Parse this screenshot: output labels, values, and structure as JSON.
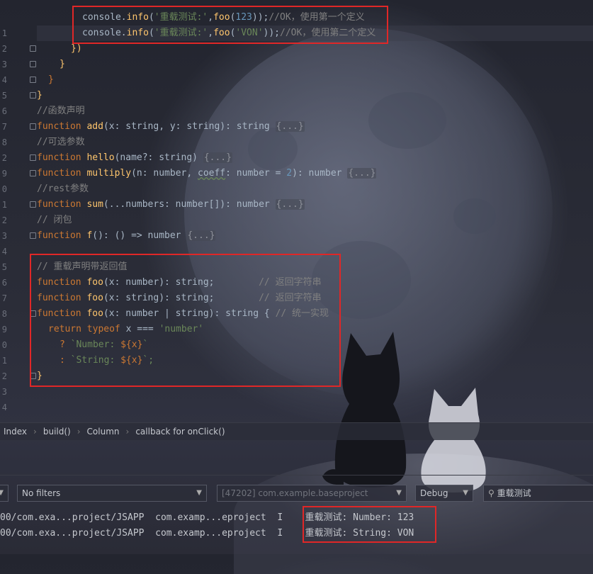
{
  "editor": {
    "line_numbers": [
      "",
      "1",
      "2",
      "3",
      "4",
      "5",
      "6",
      "7",
      "8",
      "2",
      "9",
      "0",
      "1",
      "2",
      "3",
      "4",
      "5",
      "6",
      "7",
      "8",
      "9",
      "0",
      "1",
      "2",
      "3",
      "4",
      "5"
    ],
    "box1": {
      "line1": {
        "obj": "console",
        "method": "info",
        "s1": "'重载测试:'",
        "fn": "foo",
        "arg": "123",
        "comment": "//OK，使用第一个定义"
      },
      "line2": {
        "obj": "console",
        "method": "info",
        "s1": "'重载测试:'",
        "fn": "foo",
        "arg": "'VON'",
        "comment": "//OK，使用第二个定义"
      }
    },
    "close1": "})",
    "close2": "}",
    "close3": "}",
    "close4": "}",
    "c_func_decl": "//函数声明",
    "add": {
      "kw": "function",
      "name": "add",
      "sig": "(x: string, y: string): string",
      "fold": "{...}"
    },
    "c_optional": "//可选参数",
    "hello": {
      "kw": "function",
      "name": "hello",
      "sig": "(name?: string)",
      "fold": "{...}"
    },
    "multiply": {
      "kw": "function",
      "name": "multiply",
      "sig1": "(n: number, ",
      "coeff": "coeff",
      "sig2": ": number = ",
      "def": "2",
      "sig3": "): number",
      "fold": "{...}"
    },
    "c_rest": "//rest参数",
    "sum": {
      "kw": "function",
      "name": "sum",
      "sig": "(...numbers: number[]): number",
      "fold": "{...}"
    },
    "c_closure": "// 闭包",
    "f": {
      "kw": "function",
      "name": "f",
      "sig": "(): () => number",
      "fold": "{...}"
    },
    "box2": {
      "comment": "// 重载声明带返回值",
      "o1": {
        "kw": "function",
        "name": "foo",
        "sig": "(x: number): string;",
        "comment": "// 返回字符串"
      },
      "o2": {
        "kw": "function",
        "name": "foo",
        "sig": "(x: string): string;",
        "comment": "// 返回字符串"
      },
      "o3": {
        "kw": "function",
        "name": "foo",
        "sig": "(x: number | string): string {",
        "comment": "// 统一实现"
      },
      "ret": {
        "kw1": "return",
        "kw2": "typeof",
        "rest": " x === ",
        "str": "'number'"
      },
      "t1": {
        "pre": "? ",
        "str1": "`Number: ",
        "ex": "${x}",
        "str2": "`"
      },
      "t2": {
        "pre": ": ",
        "str1": "`String: ",
        "ex": "${x}",
        "str2": "`;"
      },
      "close": "}"
    }
  },
  "breadcrumb": [
    "Index",
    "build()",
    "Column",
    "callback for onClick()"
  ],
  "log_toolbar": {
    "filter": "No filters",
    "process": "[47202] com.example.baseproject",
    "level": "Debug",
    "search": "重载测试"
  },
  "logs": [
    {
      "tag": "00/com.exa...project/JSAPP",
      "pkg": "com.examp...eproject",
      "lvl": "I",
      "msg": "重载测试: Number: 123"
    },
    {
      "tag": "00/com.exa...project/JSAPP",
      "pkg": "com.examp...eproject",
      "lvl": "I",
      "msg": "重载测试: String: VON"
    }
  ],
  "colors": {
    "accent_box": "#e02727",
    "keyword": "#cc7832",
    "function": "#ffc66d",
    "string": "#6a8759",
    "number": "#6897bb",
    "comment": "#808080"
  }
}
